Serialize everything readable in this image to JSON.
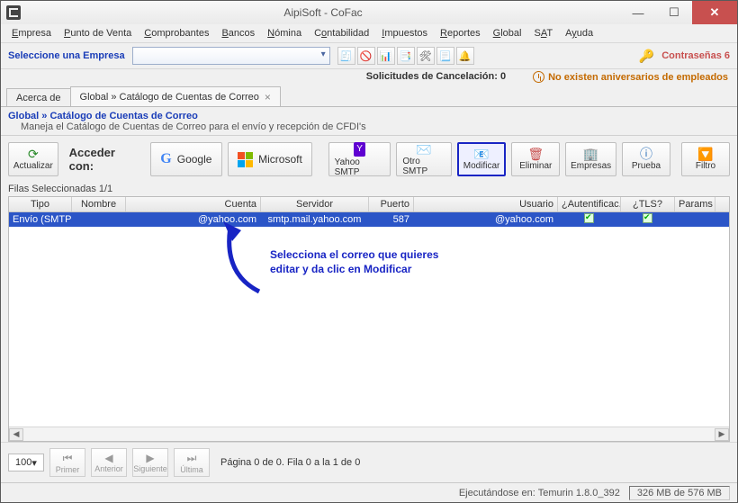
{
  "window": {
    "title": "AipiSoft - CoFac"
  },
  "menubar": [
    "Empresa",
    "Punto de Venta",
    "Comprobantes",
    "Bancos",
    "Nómina",
    "Contabilidad",
    "Impuestos",
    "Reportes",
    "Global",
    "SAT",
    "Ayuda"
  ],
  "topbar": {
    "select_label": "Seleccione una Empresa",
    "cancel_requests": "Solicitudes de Cancelación: 0",
    "anniversaries": "No existen aniversarios de empleados",
    "passwords": "Contraseñas 6"
  },
  "tabs": {
    "about": "Acerca de",
    "active": "Global » Catálogo de Cuentas de Correo"
  },
  "section": {
    "title": "Global » Catálogo de Cuentas de Correo",
    "subtitle": "Maneja el Catálogo de Cuentas de Correo para el envío y recepción de CFDI's"
  },
  "toolbar": {
    "actualizar": "Actualizar",
    "acceder_lbl": "Acceder con:",
    "google": "Google",
    "microsoft": "Microsoft",
    "yahoo": "Yahoo SMTP",
    "otro": "Otro SMTP",
    "modificar": "Modificar",
    "eliminar": "Eliminar",
    "empresas": "Empresas",
    "prueba": "Prueba",
    "filtro": "Filtro"
  },
  "grid": {
    "sel_label": "Filas Seleccionadas 1/1",
    "headers": [
      "Tipo",
      "Nombre",
      "Cuenta",
      "Servidor",
      "Puerto",
      "Usuario",
      "¿Autentificac...",
      "¿TLS?",
      "Params"
    ],
    "row": {
      "tipo": "Envío (SMTP)",
      "nombre": "",
      "cuenta": "@yahoo.com",
      "servidor": "smtp.mail.yahoo.com",
      "puerto": "587",
      "usuario": "@yahoo.com",
      "auth": true,
      "tls": true,
      "params": ""
    }
  },
  "annotation": "Selecciona  el correo que quieres editar y da clic en Modificar",
  "pager": {
    "size": "100",
    "primer": "Primer",
    "anterior": "Anterior",
    "siguiente": "Siguiente",
    "ultima": "Última",
    "status": "Página 0 de 0. Fila 0 a la 1 de 0"
  },
  "status": {
    "runtime": "Ejecutándose en:   Temurin 1.8.0_392",
    "memory": "326 MB de 576 MB"
  }
}
